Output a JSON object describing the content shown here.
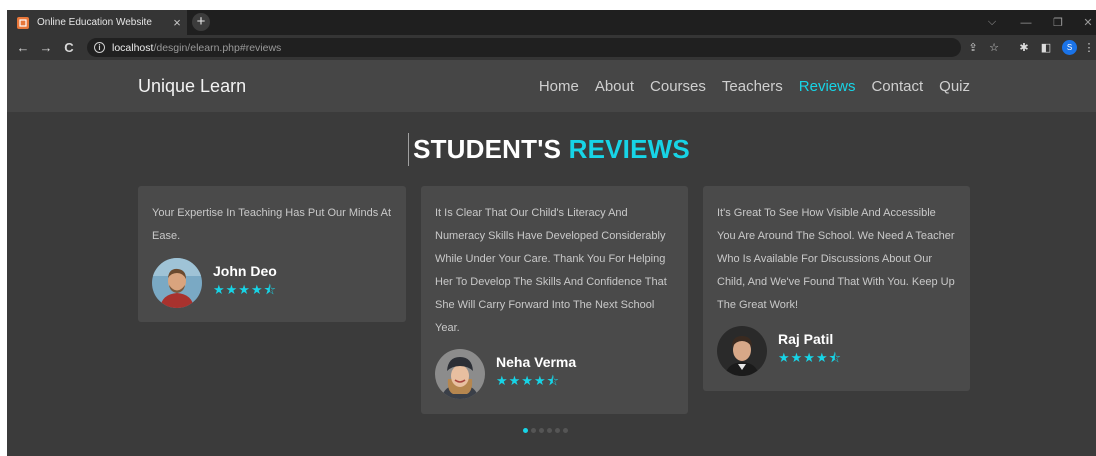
{
  "browser": {
    "tab_title": "Online Education Website",
    "tab_close": "×",
    "new_tab": "+",
    "url_host": "localhost",
    "url_path": "/desgin/elearn.php#reviews",
    "profile_initial": "S",
    "controls": {
      "dropdown": "⌵",
      "minimize": "—",
      "restore": "❐",
      "close": "✕"
    },
    "nav": {
      "back": "←",
      "forward": "→",
      "reload": "C"
    }
  },
  "site": {
    "logo": "Unique Learn",
    "nav_items": [
      {
        "label": "Home"
      },
      {
        "label": "About"
      },
      {
        "label": "Courses"
      },
      {
        "label": "Teachers"
      },
      {
        "label": "Reviews",
        "active": true
      },
      {
        "label": "Contact"
      },
      {
        "label": "Quiz"
      }
    ]
  },
  "reviews": {
    "title_main": "STUDENT'S",
    "title_accent": "REVIEWS",
    "accent_color": "#17d4e6",
    "cards": [
      {
        "text": "Your Expertise In Teaching Has Put Our Minds At Ease.",
        "name": "John Deo",
        "stars": "★★★★⯪",
        "rating": 4.5
      },
      {
        "text": "It Is Clear That Our Child's Literacy And Numeracy Skills Have Developed Considerably While Under Your Care. Thank You For Helping Her To Develop The Skills And Confidence That She Will Carry Forward Into The Next School Year.",
        "name": "Neha Verma",
        "stars": "★★★★⯪",
        "rating": 4.5
      },
      {
        "text": "It's Great To See How Visible And Accessible You Are Around The School. We Need A Teacher Who Is Available For Discussions About Our Child, And We've Found That With You. Keep Up The Great Work!",
        "name": "Raj Patil",
        "stars": "★★★★⯪",
        "rating": 4.5
      }
    ],
    "pagination": {
      "total": 6,
      "active": 1
    }
  }
}
